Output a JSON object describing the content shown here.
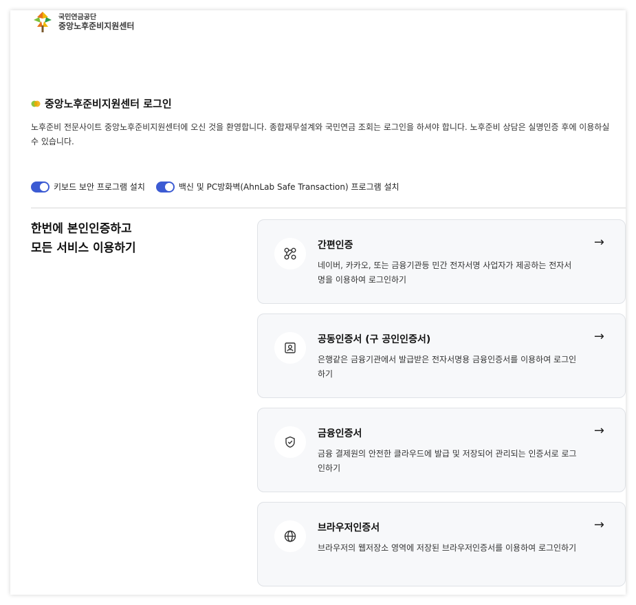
{
  "logo": {
    "org_line1": "국민연금공단",
    "org_line2": "중앙노후준비지원센터"
  },
  "page": {
    "title": "중앙노후준비지원센터 로그인",
    "description": "노후준비 전문사이트 중앙노후준비지원센터에 오신 것을 환영합니다. 종합재무설계와 국민연금 조회는 로그인을 하셔야 합니다. 노후준비 상담은 실명인증 후에 이용하실 수 있습니다."
  },
  "toggles": [
    {
      "label": "키보드 보안 프로그램 설치",
      "on": true
    },
    {
      "label": "백신 및 PC방화벽(AhnLab Safe Transaction) 프로그램 설치",
      "on": true
    }
  ],
  "left": {
    "heading_line1": "한번에 본인인증하고",
    "heading_line2": "모든 서비스 이용하기"
  },
  "cards": [
    {
      "icon": "link-icon",
      "title": "간편인증",
      "desc": "네이버, 카카오, 또는 금융기관등 민간 전자서명 사업자가 제공하는 전자서명을 이용하여 로그인하기",
      "arrow": "→"
    },
    {
      "icon": "id-card-icon",
      "title": "공동인증서 (구 공인인증서)",
      "desc": "은행같은 금융기관에서 발급받은 전자서명용 금융인증서를 이용하여 로그인하기",
      "arrow": "→"
    },
    {
      "icon": "shield-check-icon",
      "title": "금융인증서",
      "desc": "금융 결제원의 안전한 클라우드에 발급 및 저장되어 관리되는 인증서로 로그인하기",
      "arrow": "→"
    },
    {
      "icon": "globe-icon",
      "title": "브라우저인증서",
      "desc": "브라우저의 웹저장소 영역에 저장된 브라우저인증서를 이용하여 로그인하기",
      "arrow": "→"
    }
  ],
  "colors": {
    "accent": "#3c5bd3",
    "card_bg": "#f7f8fa"
  }
}
